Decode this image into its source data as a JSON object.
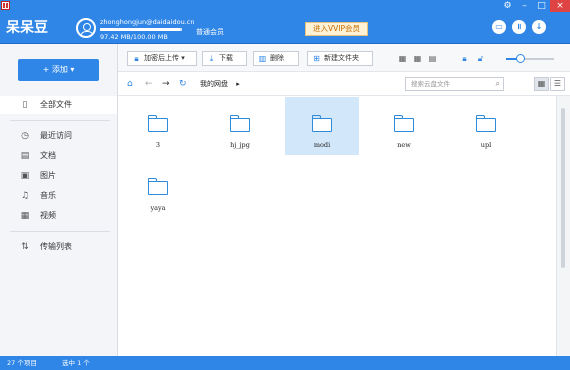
{
  "app": {
    "title": "呆呆豆"
  },
  "user": {
    "email": "zhonghongjun@daidaidou.cn",
    "level": "普通会员",
    "quota_text": "97.42 MB/100.00 MB",
    "quota_fraction": 0.97
  },
  "header": {
    "vip_label": "进入VVIP会员"
  },
  "window_controls": [
    "gear-icon",
    "minimize-icon",
    "maximize-icon",
    "close-icon"
  ],
  "sidebar": {
    "add_label": "+ 添加  ▾",
    "items": [
      {
        "label": "全部文件",
        "icon": "document-icon"
      },
      {
        "label": "最近访问",
        "icon": "clock-icon"
      },
      {
        "label": "文档",
        "icon": "doc-icon"
      },
      {
        "label": "图片",
        "icon": "image-icon"
      },
      {
        "label": "音乐",
        "icon": "music-icon"
      },
      {
        "label": "视频",
        "icon": "video-icon"
      },
      {
        "label": "传输列表",
        "icon": "transfer-icon"
      }
    ]
  },
  "toolbar": {
    "upload_label": "加密后上传 ▾",
    "download_label": "下载",
    "delete_label": "删除",
    "newfolder_label": "新建文件夹",
    "zoom_fraction": 0.3
  },
  "address": {
    "path": "我的网盘",
    "search_placeholder": "搜索云盘文件"
  },
  "files": [
    {
      "name": "3",
      "selected": false
    },
    {
      "name": "hj_jpg",
      "selected": false
    },
    {
      "name": "modi",
      "selected": true
    },
    {
      "name": "new",
      "selected": false
    },
    {
      "name": "upl",
      "selected": false
    },
    {
      "name": "yaya",
      "selected": false
    }
  ],
  "status": {
    "count_text": "27 个项目",
    "selected_text": "选中 1 个"
  }
}
